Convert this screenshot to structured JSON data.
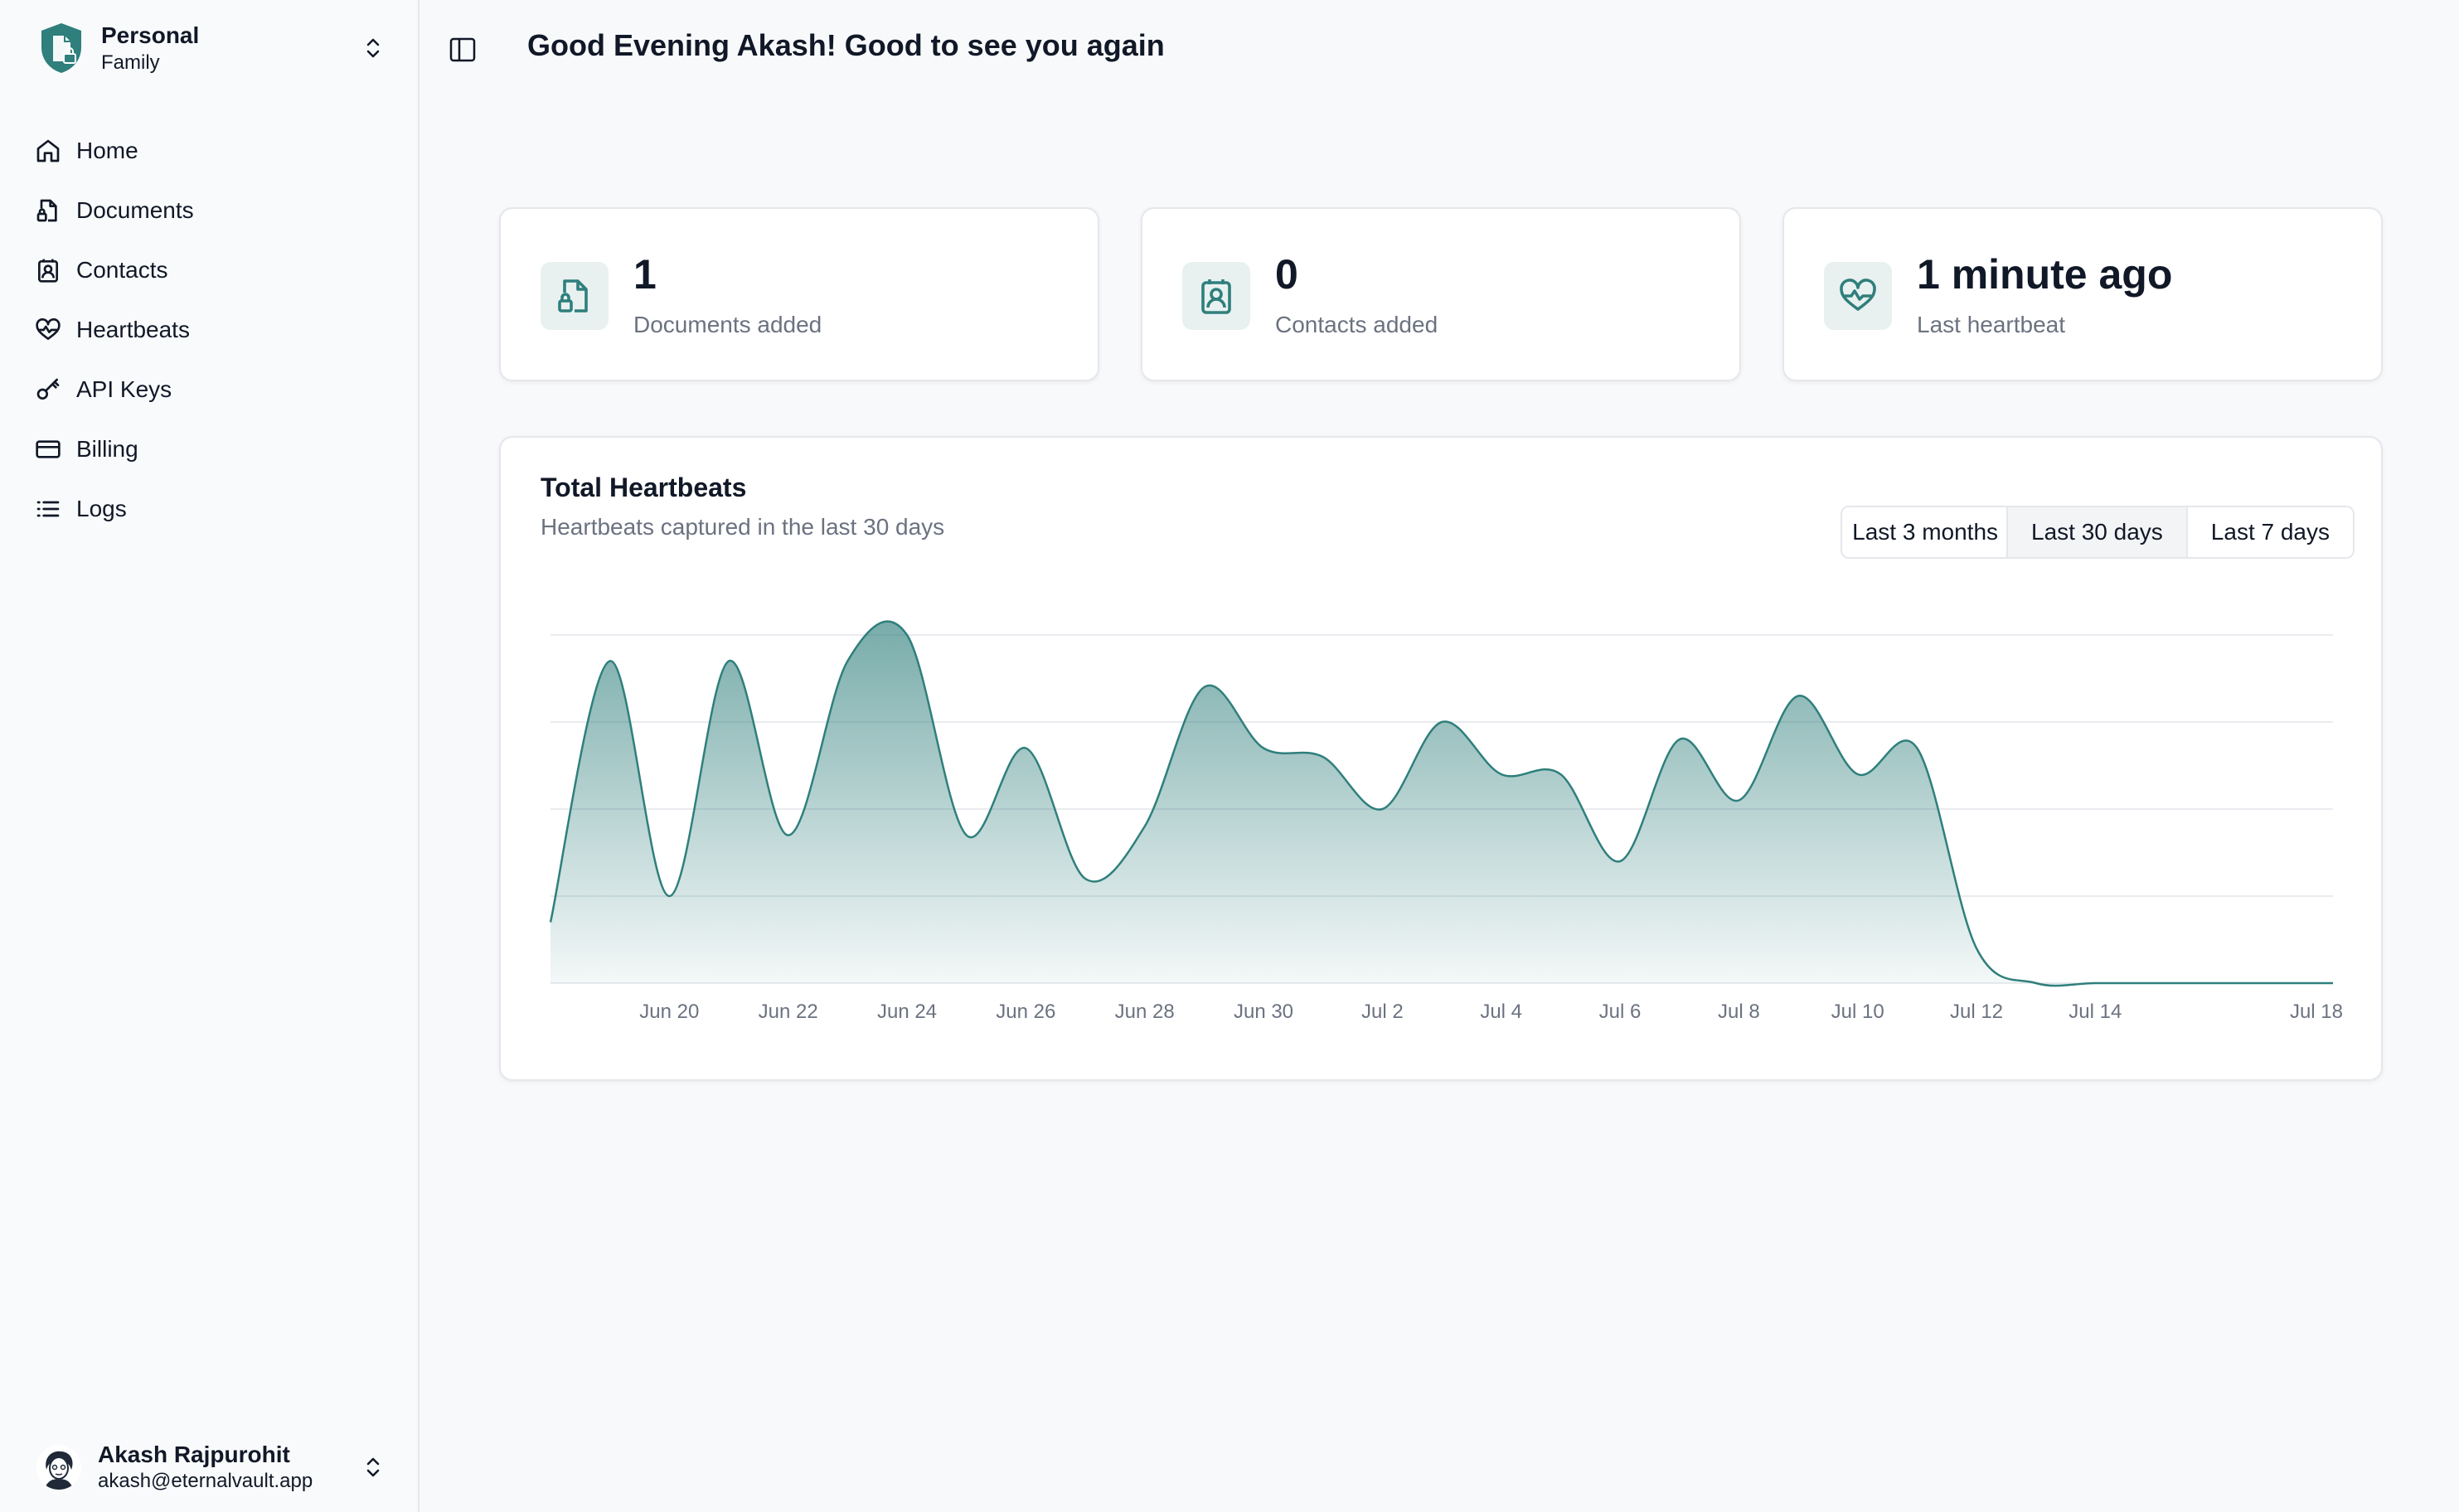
{
  "workspace": {
    "name": "Personal",
    "sub": "Family"
  },
  "nav": [
    {
      "label": "Home",
      "icon": "home-icon"
    },
    {
      "label": "Documents",
      "icon": "document-lock-icon"
    },
    {
      "label": "Contacts",
      "icon": "contact-icon"
    },
    {
      "label": "Heartbeats",
      "icon": "heart-pulse-icon"
    },
    {
      "label": "API Keys",
      "icon": "key-icon"
    },
    {
      "label": "Billing",
      "icon": "credit-card-icon"
    },
    {
      "label": "Logs",
      "icon": "list-icon"
    }
  ],
  "user": {
    "name": "Akash Rajpurohit",
    "email": "akash@eternalvault.app"
  },
  "header": {
    "greeting": "Good Evening Akash! Good to see you again"
  },
  "stats": [
    {
      "value": "1",
      "label": "Documents added",
      "icon": "document-lock-icon"
    },
    {
      "value": "0",
      "label": "Contacts added",
      "icon": "contact-icon"
    },
    {
      "value": "1 minute ago",
      "label": "Last heartbeat",
      "icon": "heart-pulse-icon"
    }
  ],
  "chart": {
    "title": "Total Heartbeats",
    "subtitle": "Heartbeats captured in the last 30 days",
    "ranges": [
      "Last 3 months",
      "Last 30 days",
      "Last 7 days"
    ],
    "active_range": "Last 30 days"
  },
  "colors": {
    "accent": "#2f7f7c",
    "accent_fill": "#5f9f9d",
    "muted": "#6b7280"
  },
  "chart_data": {
    "type": "area",
    "x": [
      "Jun 18",
      "Jun 19",
      "Jun 20",
      "Jun 21",
      "Jun 22",
      "Jun 23",
      "Jun 24",
      "Jun 25",
      "Jun 26",
      "Jun 27",
      "Jun 28",
      "Jun 29",
      "Jun 30",
      "Jul 1",
      "Jul 2",
      "Jul 3",
      "Jul 4",
      "Jul 5",
      "Jul 6",
      "Jul 7",
      "Jul 8",
      "Jul 9",
      "Jul 10",
      "Jul 11",
      "Jul 12",
      "Jul 13",
      "Jul 14",
      "Jul 15",
      "Jul 16",
      "Jul 17",
      "Jul 18"
    ],
    "values": [
      7,
      37,
      10,
      37,
      17,
      37,
      40,
      17,
      27,
      12,
      18,
      34,
      27,
      26,
      20,
      30,
      24,
      24,
      14,
      28,
      21,
      33,
      24,
      27,
      4,
      0,
      0,
      0,
      0,
      0,
      0
    ],
    "xticks": [
      "Jun 20",
      "Jun 22",
      "Jun 24",
      "Jun 26",
      "Jun 28",
      "Jun 30",
      "Jul 2",
      "Jul 4",
      "Jul 6",
      "Jul 8",
      "Jul 10",
      "Jul 12",
      "Jul 14",
      "Jul 18"
    ],
    "ylim": [
      0,
      40
    ],
    "grid": true
  }
}
